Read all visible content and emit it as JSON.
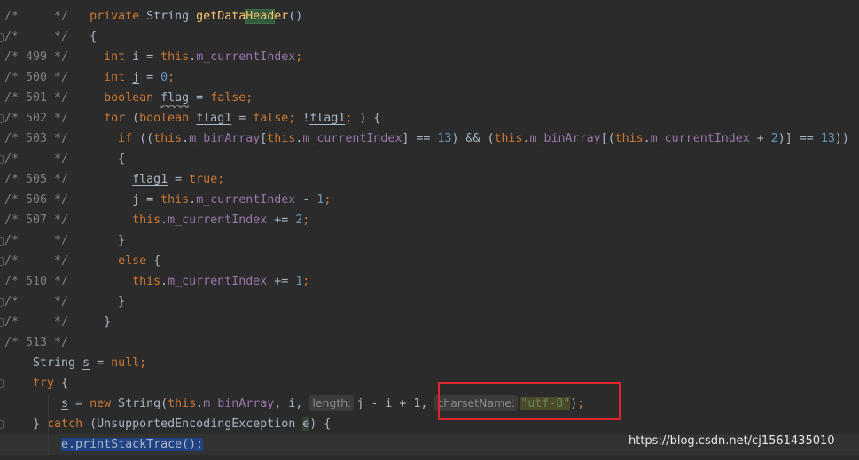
{
  "editor": {
    "lines": [
      {
        "fold": false,
        "tokens": [
          {
            "t": "/*     */   ",
            "s": "c"
          },
          {
            "t": "private ",
            "s": "k"
          },
          {
            "t": "String ",
            "s": "p"
          },
          {
            "t": "getData",
            "s": "m"
          },
          {
            "t": "Head",
            "s": "mh"
          },
          {
            "t": "er",
            "s": "m"
          },
          {
            "t": "()",
            "s": "p"
          }
        ]
      },
      {
        "fold": true,
        "tokens": [
          {
            "t": "/*     */   ",
            "s": "c"
          },
          {
            "t": "{",
            "s": "p"
          }
        ]
      },
      {
        "fold": false,
        "tokens": [
          {
            "t": "/* 499 */     ",
            "s": "c"
          },
          {
            "t": "int ",
            "s": "k"
          },
          {
            "t": "i = ",
            "s": "p"
          },
          {
            "t": "this",
            "s": "k"
          },
          {
            "t": ".",
            "s": "p"
          },
          {
            "t": "m_currentIndex",
            "s": "f"
          },
          {
            "t": ";",
            "s": "k"
          }
        ]
      },
      {
        "fold": false,
        "tokens": [
          {
            "t": "/* 500 */     ",
            "s": "c"
          },
          {
            "t": "int ",
            "s": "k"
          },
          {
            "t": "j",
            "s": "u"
          },
          {
            "t": " = ",
            "s": "p"
          },
          {
            "t": "0",
            "s": "n"
          },
          {
            "t": ";",
            "s": "k"
          }
        ]
      },
      {
        "fold": false,
        "tokens": [
          {
            "t": "/* 501 */     ",
            "s": "c"
          },
          {
            "t": "boolean ",
            "s": "k"
          },
          {
            "t": "flag",
            "s": "w"
          },
          {
            "t": " = ",
            "s": "p"
          },
          {
            "t": "false",
            "s": "k"
          },
          {
            "t": ";",
            "s": "k"
          }
        ]
      },
      {
        "fold": true,
        "tokens": [
          {
            "t": "/* 502 */     ",
            "s": "c"
          },
          {
            "t": "for ",
            "s": "k"
          },
          {
            "t": "(",
            "s": "p"
          },
          {
            "t": "boolean ",
            "s": "k"
          },
          {
            "t": "flag1",
            "s": "u"
          },
          {
            "t": " = ",
            "s": "p"
          },
          {
            "t": "false",
            "s": "k"
          },
          {
            "t": "; ",
            "s": "k"
          },
          {
            "t": "!",
            "s": "p"
          },
          {
            "t": "flag1",
            "s": "u"
          },
          {
            "t": "; ",
            "s": "k"
          },
          {
            "t": ") {",
            "s": "p"
          }
        ]
      },
      {
        "fold": false,
        "tokens": [
          {
            "t": "/* 503 */       ",
            "s": "c"
          },
          {
            "t": "if ",
            "s": "k"
          },
          {
            "t": "((",
            "s": "p"
          },
          {
            "t": "this",
            "s": "k"
          },
          {
            "t": ".",
            "s": "p"
          },
          {
            "t": "m_binArray",
            "s": "f"
          },
          {
            "t": "[",
            "s": "p"
          },
          {
            "t": "this",
            "s": "k"
          },
          {
            "t": ".",
            "s": "p"
          },
          {
            "t": "m_currentIndex",
            "s": "f"
          },
          {
            "t": "] == ",
            "s": "p"
          },
          {
            "t": "13",
            "s": "n"
          },
          {
            "t": ") && (",
            "s": "p"
          },
          {
            "t": "this",
            "s": "k"
          },
          {
            "t": ".",
            "s": "p"
          },
          {
            "t": "m_binArray",
            "s": "f"
          },
          {
            "t": "[(",
            "s": "p"
          },
          {
            "t": "this",
            "s": "k"
          },
          {
            "t": ".",
            "s": "p"
          },
          {
            "t": "m_currentIndex",
            "s": "f"
          },
          {
            "t": " + ",
            "s": "p"
          },
          {
            "t": "2",
            "s": "n"
          },
          {
            "t": ")] == ",
            "s": "p"
          },
          {
            "t": "13",
            "s": "n"
          },
          {
            "t": "))",
            "s": "p"
          }
        ]
      },
      {
        "fold": true,
        "tokens": [
          {
            "t": "/*     */       ",
            "s": "c"
          },
          {
            "t": "{",
            "s": "p"
          }
        ]
      },
      {
        "fold": false,
        "tokens": [
          {
            "t": "/* 505 */         ",
            "s": "c"
          },
          {
            "t": "flag1",
            "s": "u"
          },
          {
            "t": " = ",
            "s": "p"
          },
          {
            "t": "true",
            "s": "k"
          },
          {
            "t": ";",
            "s": "k"
          }
        ]
      },
      {
        "fold": false,
        "tokens": [
          {
            "t": "/* 506 */         ",
            "s": "c"
          },
          {
            "t": "j = ",
            "s": "p"
          },
          {
            "t": "this",
            "s": "k"
          },
          {
            "t": ".",
            "s": "p"
          },
          {
            "t": "m_currentIndex",
            "s": "f"
          },
          {
            "t": " - ",
            "s": "p"
          },
          {
            "t": "1",
            "s": "n"
          },
          {
            "t": ";",
            "s": "k"
          }
        ]
      },
      {
        "fold": false,
        "tokens": [
          {
            "t": "/* 507 */         ",
            "s": "c"
          },
          {
            "t": "this",
            "s": "k"
          },
          {
            "t": ".",
            "s": "p"
          },
          {
            "t": "m_currentIndex",
            "s": "f"
          },
          {
            "t": " += ",
            "s": "p"
          },
          {
            "t": "2",
            "s": "n"
          },
          {
            "t": ";",
            "s": "k"
          }
        ]
      },
      {
        "fold": true,
        "tokens": [
          {
            "t": "/*     */       ",
            "s": "c"
          },
          {
            "t": "}",
            "s": "p"
          }
        ]
      },
      {
        "fold": true,
        "tokens": [
          {
            "t": "/*     */       ",
            "s": "c"
          },
          {
            "t": "else ",
            "s": "k"
          },
          {
            "t": "{",
            "s": "p"
          }
        ]
      },
      {
        "fold": false,
        "tokens": [
          {
            "t": "/* 510 */         ",
            "s": "c"
          },
          {
            "t": "this",
            "s": "k"
          },
          {
            "t": ".",
            "s": "p"
          },
          {
            "t": "m_currentIndex",
            "s": "f"
          },
          {
            "t": " += ",
            "s": "p"
          },
          {
            "t": "1",
            "s": "n"
          },
          {
            "t": ";",
            "s": "k"
          }
        ]
      },
      {
        "fold": true,
        "tokens": [
          {
            "t": "/*     */       ",
            "s": "c"
          },
          {
            "t": "}",
            "s": "p"
          }
        ]
      },
      {
        "fold": true,
        "tokens": [
          {
            "t": "/*     */     ",
            "s": "c"
          },
          {
            "t": "}",
            "s": "p"
          }
        ]
      },
      {
        "fold": false,
        "tokens": [
          {
            "t": "/* 513 */",
            "s": "c"
          }
        ]
      },
      {
        "fold": false,
        "tokens": [
          {
            "t": "    ",
            "s": "p"
          },
          {
            "t": "String ",
            "s": "p"
          },
          {
            "t": "s",
            "s": "u"
          },
          {
            "t": " = ",
            "s": "p"
          },
          {
            "t": "null",
            "s": "k"
          },
          {
            "t": ";",
            "s": "k"
          }
        ]
      },
      {
        "fold": true,
        "tokens": [
          {
            "t": "    ",
            "s": "p"
          },
          {
            "t": "try ",
            "s": "k"
          },
          {
            "t": "{",
            "s": "p"
          }
        ]
      },
      {
        "fold": false,
        "tokens": [
          {
            "t": "        ",
            "s": "p"
          },
          {
            "t": "s",
            "s": "u"
          },
          {
            "t": " = ",
            "s": "p"
          },
          {
            "t": "new ",
            "s": "k"
          },
          {
            "t": "String(",
            "s": "p"
          },
          {
            "t": "this",
            "s": "k"
          },
          {
            "t": ".",
            "s": "p"
          },
          {
            "t": "m_binArray",
            "s": "f"
          },
          {
            "t": ", i, ",
            "s": "p"
          },
          {
            "t": "length:",
            "s": "h"
          },
          {
            "t": "j - i + 1, ",
            "s": "p"
          },
          {
            "t": "charsetName:",
            "s": "h"
          },
          {
            "t": "\"utf-8\"",
            "s": "s"
          },
          {
            "t": ")",
            "s": "p"
          },
          {
            "t": ";",
            "s": "k"
          }
        ]
      },
      {
        "fold": true,
        "tokens": [
          {
            "t": "    ",
            "s": "p"
          },
          {
            "t": "} ",
            "s": "p"
          },
          {
            "t": "catch ",
            "s": "k"
          },
          {
            "t": "(UnsupportedEncodingException ",
            "s": "p"
          },
          {
            "t": "e",
            "s": "ph"
          },
          {
            "t": ") {",
            "s": "p"
          }
        ]
      },
      {
        "fold": false,
        "current": true,
        "tokens": [
          {
            "t": "        ",
            "s": "p"
          },
          {
            "t": "e.printStackTrace();",
            "s": "sel"
          }
        ]
      }
    ]
  },
  "watermark": "https://blog.csdn.net/cj1561435010",
  "colors": {
    "background": "#2b2b2b",
    "keyword": "#cc7832",
    "field": "#9876aa",
    "number": "#6897bb",
    "method": "#ffc66d",
    "string": "#6a8759",
    "selection": "#214283",
    "highlight_box": "#e0262b"
  }
}
